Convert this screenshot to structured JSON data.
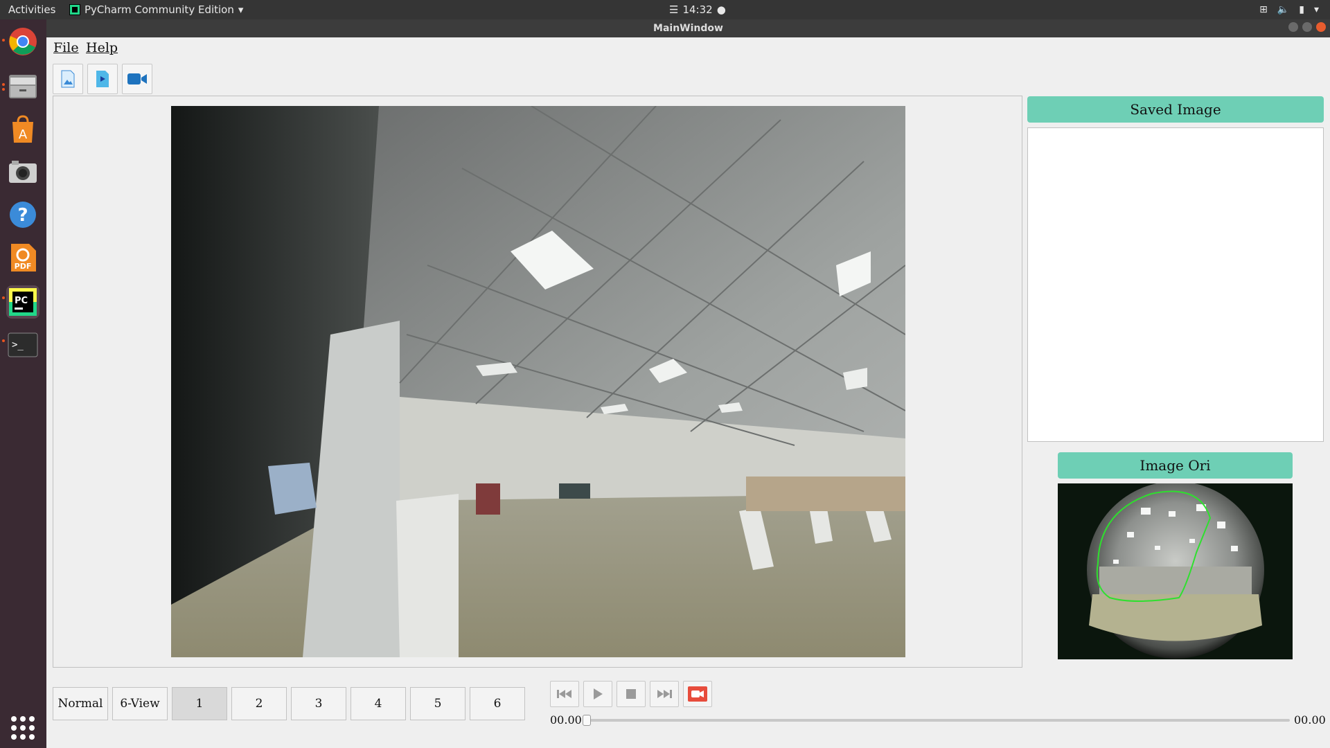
{
  "topbar": {
    "activities": "Activities",
    "app_name": "PyCharm Community Edition",
    "clock": "14:32"
  },
  "window": {
    "title": "MainWindow"
  },
  "menu": {
    "file": "File",
    "help": "Help"
  },
  "panels": {
    "saved_title": "Saved Image",
    "ori_title": "Image Ori"
  },
  "view_buttons": {
    "normal": "Normal",
    "six_view": "6-View",
    "v1": "1",
    "v2": "2",
    "v3": "3",
    "v4": "4",
    "v5": "5",
    "v6": "6",
    "selected": "1"
  },
  "playback": {
    "time_current": "00.00",
    "time_total": "00.00",
    "progress": 0
  },
  "dock": {
    "icons": [
      "chrome-icon",
      "files-icon",
      "software-store-icon",
      "camera-icon",
      "help-icon",
      "foxit-pdf-icon",
      "pycharm-icon",
      "terminal-icon",
      "show-apps-icon"
    ]
  },
  "colors": {
    "accent": "#6ecfb5",
    "record_red": "#e74c3c",
    "dock": "#3a2a33"
  }
}
